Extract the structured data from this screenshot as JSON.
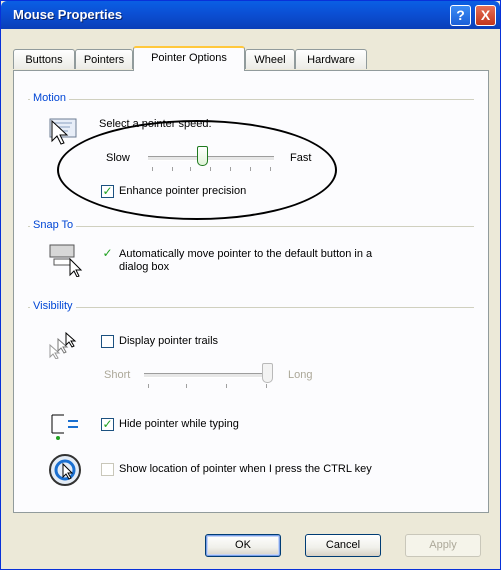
{
  "window": {
    "title": "Mouse Properties"
  },
  "titlebar": {
    "help_glyph": "?",
    "close_glyph": "X"
  },
  "tabs": [
    {
      "label": "Buttons"
    },
    {
      "label": "Pointers"
    },
    {
      "label": "Pointer Options",
      "active": true
    },
    {
      "label": "Wheel"
    },
    {
      "label": "Hardware"
    }
  ],
  "motion": {
    "heading": "Motion",
    "instruction": "Select a pointer speed:",
    "slow_label": "Slow",
    "fast_label": "Fast",
    "speed_level": 0.4,
    "enhance_label": "Enhance pointer precision",
    "enhance_checked": true
  },
  "snap_to": {
    "heading": "Snap To",
    "line1": "Automatically move pointer to the default button in a",
    "line2": "dialog box",
    "checked": true
  },
  "visibility": {
    "heading": "Visibility",
    "trails_label": "Display pointer trails",
    "trails_checked": false,
    "short_label": "Short",
    "long_label": "Long",
    "trail_level": 1.0,
    "hide_label": "Hide pointer while typing",
    "hide_checked": true,
    "ctrl_label": "Show location of pointer when I press the CTRL key",
    "ctrl_checked": false
  },
  "buttons": {
    "ok": "OK",
    "cancel": "Cancel",
    "apply": "Apply"
  },
  "colors": {
    "accent": "#0046d5",
    "titlebar": "#0a5fe4",
    "check": "#21a121"
  },
  "icons": [
    "help-icon",
    "close-icon",
    "motion-pointer-icon",
    "snap-to-icon",
    "pointer-trails-icon",
    "hide-pointer-icon",
    "ctrl-locate-icon"
  ]
}
